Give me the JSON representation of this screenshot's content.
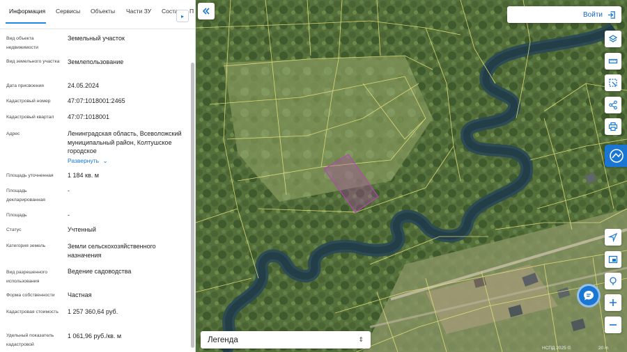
{
  "tabs": [
    {
      "label": "Информация"
    },
    {
      "label": "Сервисы"
    },
    {
      "label": "Объекты"
    },
    {
      "label": "Части ЗУ"
    },
    {
      "label": "Соста"
    },
    {
      "label": "П"
    }
  ],
  "properties": [
    {
      "label": "Вид объекта недвижимости",
      "value": "Земельный участок"
    },
    {
      "label": "Вид земельного участка",
      "value": "Землепользование"
    },
    {
      "label": "Дата присвоения",
      "value": "24.05.2024"
    },
    {
      "label": "Кадастровый номер",
      "value": "47:07:1018001:2465"
    },
    {
      "label": "Кадастровый квартал",
      "value": "47:07:1018001"
    },
    {
      "label": "Адрес",
      "value": "Ленинградская область, Всеволожский муниципальный район, Колтушское городское"
    },
    {
      "label": "Площадь уточненная",
      "value": "1 184 кв. м"
    },
    {
      "label": "Площадь декларированная",
      "value": "-"
    },
    {
      "label": "Площадь",
      "value": "-"
    },
    {
      "label": "Статус",
      "value": "Учтенный"
    },
    {
      "label": "Категория земель",
      "value": "Земли сельскохозяйственного назначения"
    },
    {
      "label": "Вид разрешенного использования",
      "value": "Ведение садоводства"
    },
    {
      "label": "Форма собственности",
      "value": "Частная"
    },
    {
      "label": "Кадастровая стоимость",
      "value": "1 257 360,64 руб."
    },
    {
      "label": "Удельный показатель кадастровой",
      "value": "1 061,96 руб./кв. м"
    }
  ],
  "expand_label": "Развернуть",
  "login_label": "Войти",
  "legend_label": "Легенда",
  "attribution": "НСПД 2025 ©",
  "scale_label": "20 m",
  "colors": {
    "accent": "#1976d2",
    "parcel_border": "#e8e27a",
    "selected_parcel": "#b04ab0"
  }
}
